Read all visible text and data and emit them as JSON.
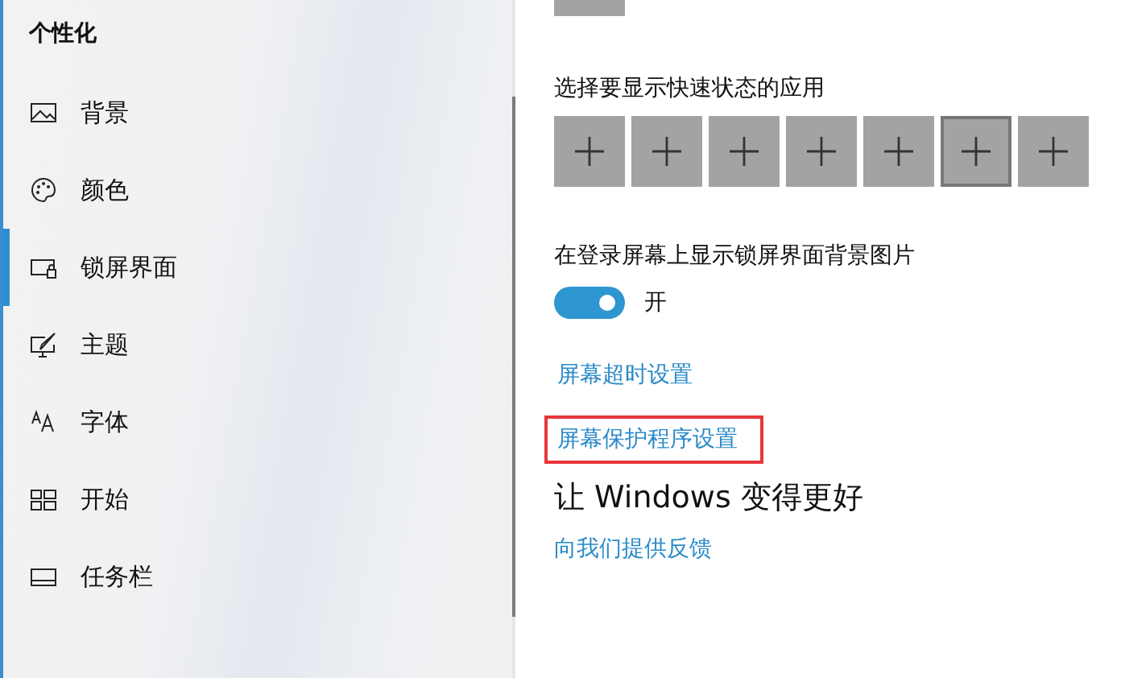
{
  "sidebar": {
    "title": "个性化",
    "items": [
      {
        "label": "背景",
        "selected": false
      },
      {
        "label": "颜色",
        "selected": false
      },
      {
        "label": "锁屏界面",
        "selected": true
      },
      {
        "label": "主题",
        "selected": false
      },
      {
        "label": "字体",
        "selected": false
      },
      {
        "label": "开始",
        "selected": false
      },
      {
        "label": "任务栏",
        "selected": false
      }
    ]
  },
  "quick_status": {
    "label": "选择要显示快速状态的应用",
    "tiles": [
      {
        "selected": false
      },
      {
        "selected": false
      },
      {
        "selected": false
      },
      {
        "selected": false
      },
      {
        "selected": false
      },
      {
        "selected": true
      },
      {
        "selected": false
      }
    ]
  },
  "background_on_signin": {
    "label": "在登录屏幕上显示锁屏界面背景图片",
    "on": true,
    "state_text": "开"
  },
  "links": [
    {
      "text": "屏幕超时设置",
      "highlighted": false
    },
    {
      "text": "屏幕保护程序设置",
      "highlighted": true
    }
  ],
  "feedback": {
    "heading": "让 Windows 变得更好",
    "link": "向我们提供反馈"
  }
}
